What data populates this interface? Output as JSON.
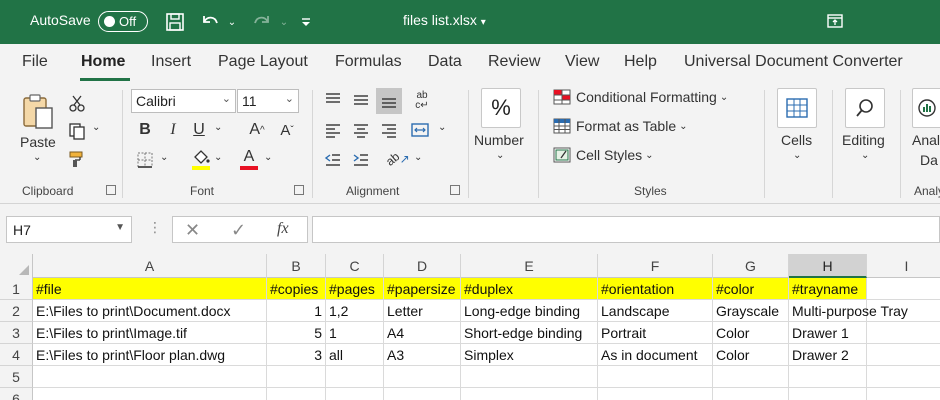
{
  "titlebar": {
    "autosave_label": "AutoSave",
    "autosave_state": "Off",
    "filename": "files list.xlsx"
  },
  "tabs": [
    "File",
    "Home",
    "Insert",
    "Page Layout",
    "Formulas",
    "Data",
    "Review",
    "View",
    "Help",
    "Universal Document Converter"
  ],
  "active_tab": "Home",
  "ribbon": {
    "clipboard": {
      "paste_label": "Paste",
      "group_label": "Clipboard"
    },
    "font": {
      "font_name": "Calibri",
      "font_size": "11",
      "group_label": "Font"
    },
    "alignment": {
      "group_label": "Alignment"
    },
    "number": {
      "label": "Number"
    },
    "styles": {
      "conditional": "Conditional Formatting",
      "format_table": "Format as Table",
      "cell_styles": "Cell Styles",
      "group_label": "Styles"
    },
    "cells": {
      "label": "Cells"
    },
    "editing": {
      "label": "Editing"
    },
    "analyze": {
      "label_top": "Anal",
      "label_bottom": "Da",
      "group_label": "Analy"
    }
  },
  "formula_bar": {
    "name_box": "H7",
    "fx": "fx",
    "formula": ""
  },
  "grid": {
    "columns": [
      "A",
      "B",
      "C",
      "D",
      "E",
      "F",
      "G",
      "H",
      "I"
    ],
    "selected_column": "H",
    "row_numbers": [
      "1",
      "2",
      "3",
      "4",
      "5",
      "6"
    ],
    "rows": [
      [
        "#file",
        "#copies",
        "#pages",
        "#papersize",
        "#duplex",
        "#orientation",
        "#color",
        "#trayname",
        ""
      ],
      [
        "E:\\Files to print\\Document.docx",
        "1",
        "1,2",
        "Letter",
        "Long-edge binding",
        "Landscape",
        "Grayscale",
        "Multi-purpose Tray",
        ""
      ],
      [
        "E:\\Files to print\\Image.tif",
        "5",
        "1",
        "A4",
        "Short-edge binding",
        "Portrait",
        "Color",
        "Drawer 1",
        ""
      ],
      [
        "E:\\Files to print\\Floor plan.dwg",
        "3",
        "all",
        "A3",
        "Simplex",
        "As in document",
        "Color",
        "Drawer 2",
        ""
      ],
      [
        "",
        "",
        "",
        "",
        "",
        "",
        "",
        "",
        ""
      ],
      [
        "",
        "",
        "",
        "",
        "",
        "",
        "",
        "",
        ""
      ]
    ],
    "header_fill": "#ffff00"
  },
  "colors": {
    "accent": "#217346",
    "highlight": "#ffff00",
    "font_red": "#e81123"
  }
}
